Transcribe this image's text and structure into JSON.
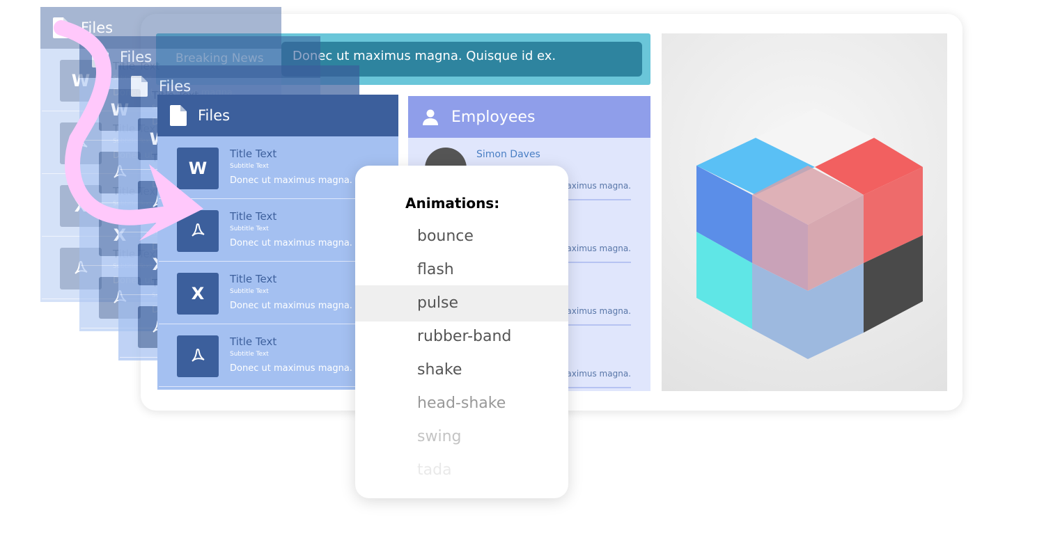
{
  "banner": {
    "label": "Breaking News",
    "text": "Donec ut maximus magna. Quisque id ex."
  },
  "employees": {
    "title": "Employees",
    "rows": [
      {
        "name": "Simon Daves",
        "text": "Donec ut maximus magna."
      },
      {
        "name": "",
        "text": "Donec ut maximus magna."
      },
      {
        "name": "",
        "text": "Donec ut maximus magna."
      },
      {
        "name": "",
        "text": "Donec ut maximus magna."
      }
    ]
  },
  "files": {
    "title": "Files",
    "rows": [
      {
        "icon": "W",
        "type": "word-icon",
        "title": "Title Text",
        "subtitle": "Subtitle Text",
        "text": "Donec ut maximus magna."
      },
      {
        "icon": "pdf",
        "type": "pdf-icon",
        "title": "Title Text",
        "subtitle": "Subtitle Text",
        "text": "Donec ut maximus magna."
      },
      {
        "icon": "X",
        "type": "excel-icon",
        "title": "Title Text",
        "subtitle": "Subtitle Text",
        "text": "Donec ut maximus magna."
      },
      {
        "icon": "pdf",
        "type": "pdf-icon",
        "title": "Title Text",
        "subtitle": "Subtitle Text",
        "text": "Donec ut maximus magna."
      }
    ]
  },
  "dropdown": {
    "heading": "Animations:",
    "selected": "pulse",
    "items": [
      "bounce",
      "flash",
      "pulse",
      "rubber-band",
      "shake",
      "head-shake",
      "swing",
      "tada"
    ]
  },
  "colors": {
    "files_header": "#3c5f9c",
    "files_body": "#a4c0f1",
    "employees_header": "#8f9eea",
    "banner": "#6ac6d9",
    "arrow": "#ffc8fb"
  }
}
